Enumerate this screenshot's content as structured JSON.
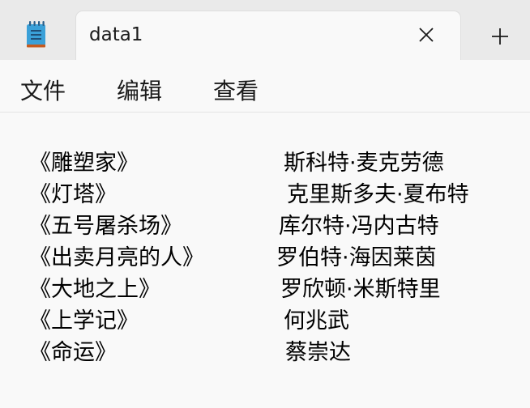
{
  "tab": {
    "title": "data1"
  },
  "menu": {
    "items": [
      "文件",
      "编辑",
      "查看"
    ]
  },
  "lines": [
    {
      "title": "《雕塑家》",
      "author": "斯科特·麦克劳德"
    },
    {
      "title": "《灯塔》",
      "author": "克里斯多夫·夏布特"
    },
    {
      "title": "《五号屠杀场》",
      "author": "库尔特·冯内古特"
    },
    {
      "title": "《出卖月亮的人》",
      "author": "罗伯特·海因莱茵"
    },
    {
      "title": "《大地之上》",
      "author": "罗欣顿·米斯特里"
    },
    {
      "title": "《上学记》",
      "author": "何兆武"
    },
    {
      "title": "《命运》",
      "author": "蔡崇达"
    }
  ],
  "colors": {
    "tabstrip": "#eaeaea",
    "background": "#f9f9f9",
    "icon_blue": "#3aa0d8",
    "icon_orange": "#c65a1e"
  }
}
